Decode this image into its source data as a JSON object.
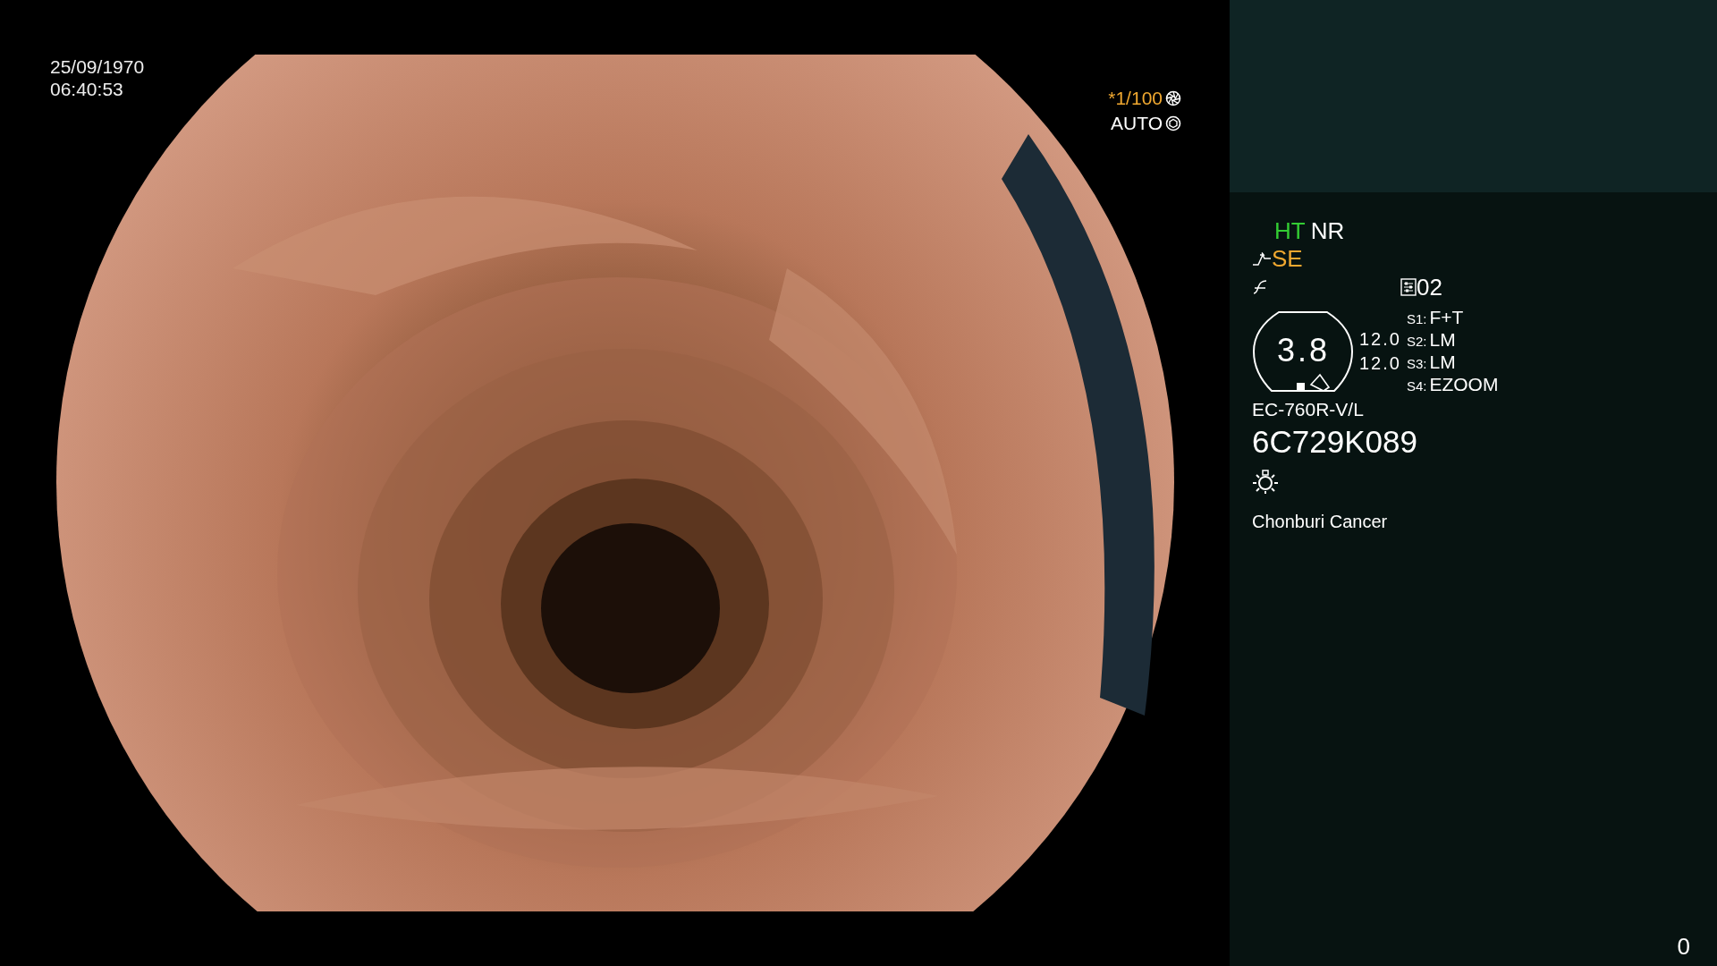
{
  "datetime": {
    "date": "25/09/1970",
    "time": "06:40:53"
  },
  "exposure": {
    "shutter": "*1/100",
    "mode": "AUTO"
  },
  "modes": [
    {
      "label": "HT",
      "color": "#33cc33"
    },
    {
      "label": "NR",
      "color": "#ffffff"
    }
  ],
  "enhancement": {
    "label": "SE"
  },
  "preset": "02",
  "gauge": {
    "value": "3.8",
    "readings": [
      "12.0",
      "12.0"
    ]
  },
  "switches": [
    {
      "key": "S1:",
      "value": "F+T"
    },
    {
      "key": "S2:",
      "value": "LM"
    },
    {
      "key": "S3:",
      "value": "LM"
    },
    {
      "key": "S4:",
      "value": "EZOOM"
    }
  ],
  "scope_model": "EC-760R-V/L",
  "serial": "6C729K089",
  "institution": "Chonburi Cancer",
  "counter": "0"
}
